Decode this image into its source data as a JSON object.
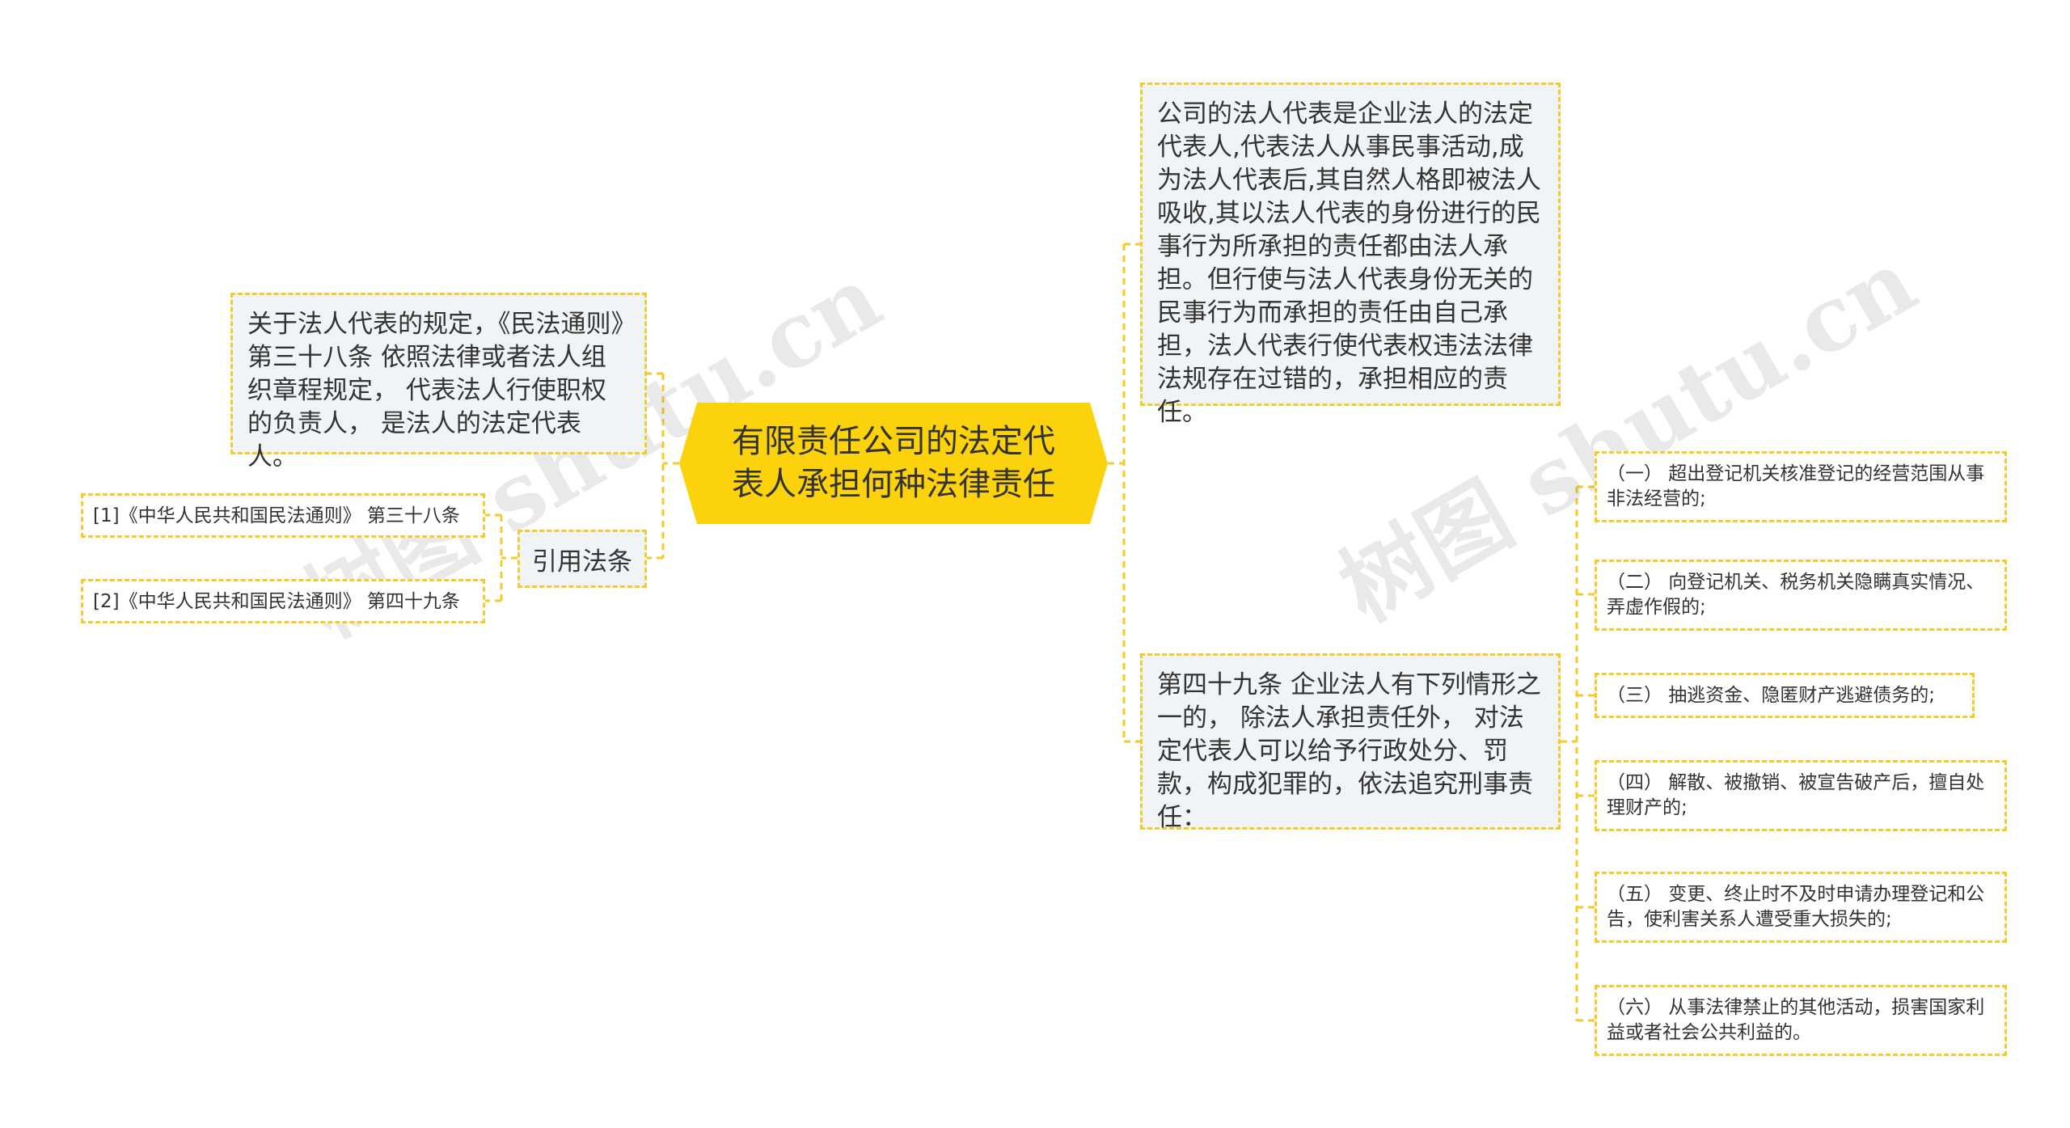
{
  "center": {
    "title": "有限责任公司的法定代表人承担何种法律责任"
  },
  "left": {
    "rule": "关于法人代表的规定，《民法通则》第三十八条 依照法律或者法人组织章程规定， 代表法人行使职权的负责人， 是法人的法定代表人。",
    "citation_label": "引用法条",
    "citations": [
      "[1]《中华人民共和国民法通则》 第三十八条",
      "[2]《中华人民共和国民法通则》 第四十九条"
    ]
  },
  "right": {
    "definition": "公司的法人代表是企业法人的法定代表人,代表法人从事民事活动,成为法人代表后,其自然人格即被法人吸收,其以法人代表的身份进行的民事行为所承担的责任都由法人承担。但行使与法人代表身份无关的民事行为而承担的责任由自己承担，法人代表行使代表权违法法律法规存在过错的，承担相应的责任。",
    "article49": "第四十九条 企业法人有下列情形之一的， 除法人承担责任外， 对法定代表人可以给予行政处分、罚款，构成犯罪的，依法追究刑事责任：",
    "items": [
      "（一） 超出登记机关核准登记的经营范围从事非法经营的;",
      "（二） 向登记机关、税务机关隐瞒真实情况、弄虚作假的;",
      "（三） 抽逃资金、隐匿财产逃避债务的;",
      "（四） 解散、被撤销、被宣告破产后，擅自处理财产的;",
      "（五） 变更、终止时不及时申请办理登记和公告，使利害关系人遭受重大损失的;",
      "（六） 从事法律禁止的其他活动，损害国家利益或者社会公共利益的。"
    ]
  },
  "watermark": "树图 shutu.cn",
  "colors": {
    "accent": "#fbd20c",
    "dash": "#f3cb2b",
    "node_bg": "#f1f4f6",
    "text": "#333333"
  }
}
